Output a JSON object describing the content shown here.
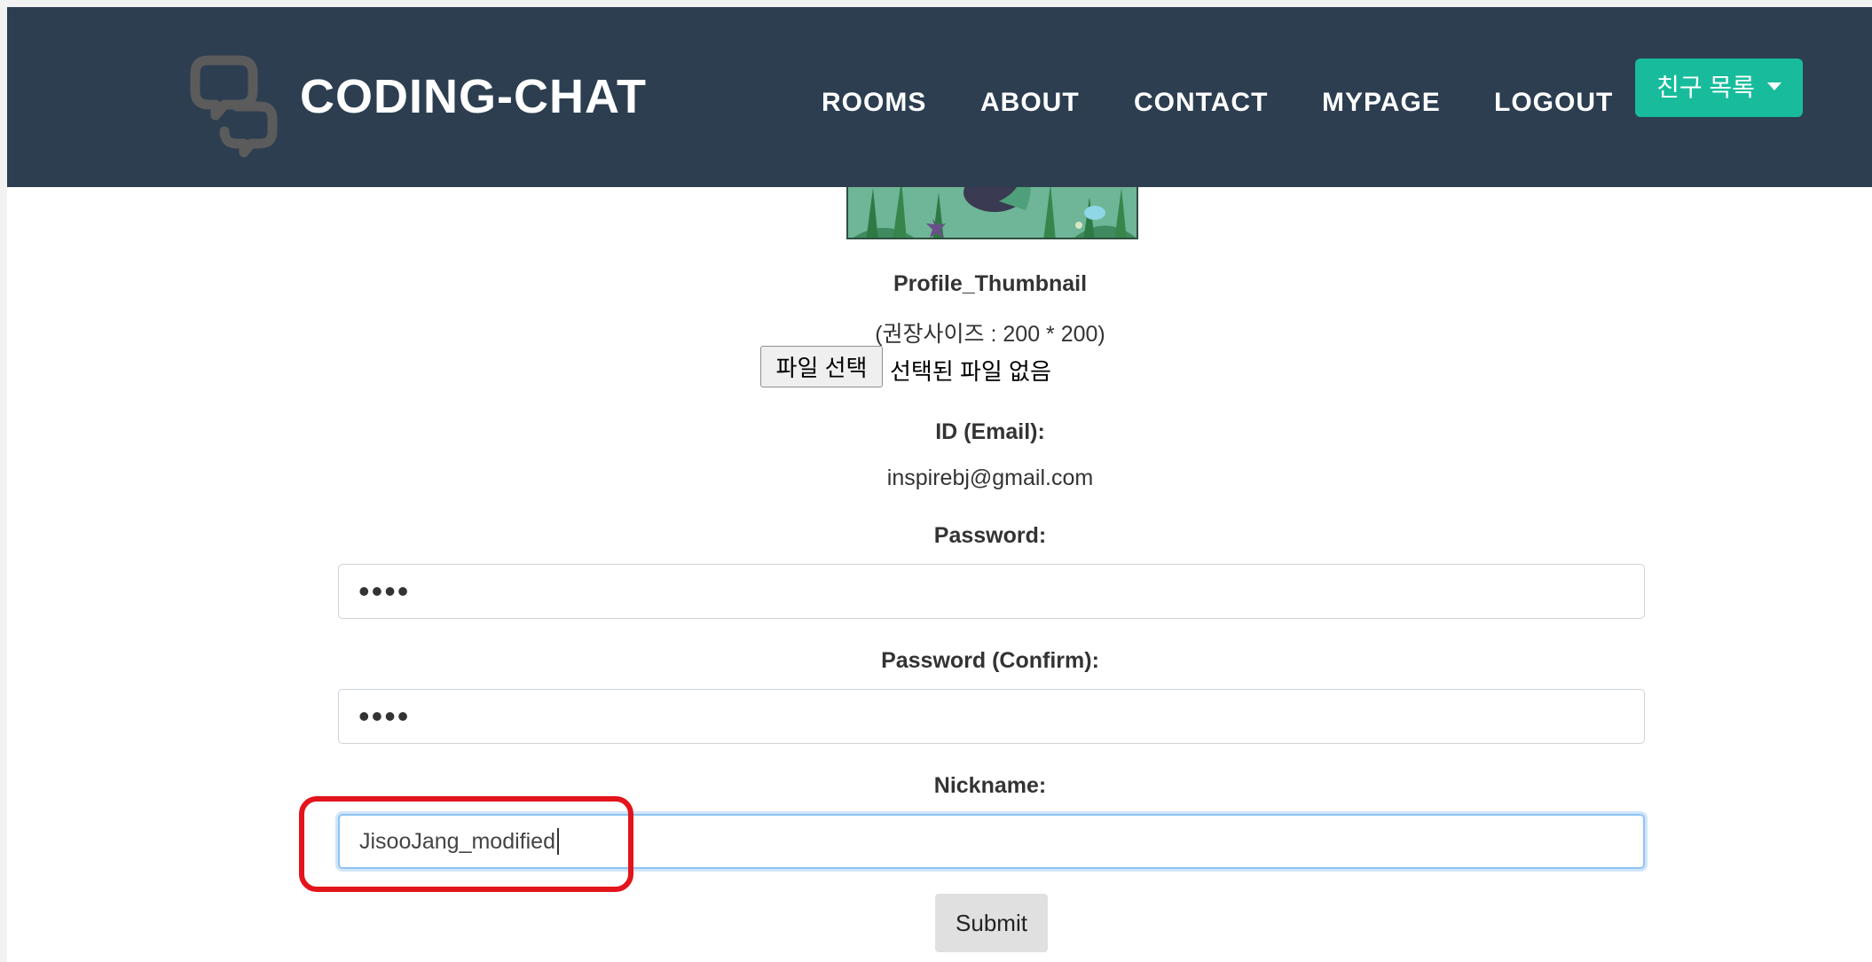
{
  "navbar": {
    "brand": "CODING-CHAT",
    "links": [
      "ROOMS",
      "ABOUT",
      "CONTACT",
      "MYPAGE",
      "LOGOUT"
    ],
    "friends_button": "친구 목록",
    "bg_color": "#2c3e50",
    "accent_color": "#18bc9c"
  },
  "profile": {
    "thumbnail_label": "Profile_Thumbnail",
    "size_hint": "(권장사이즈 : 200 * 200)",
    "file_button": "파일 선택",
    "file_status": "선택된 파일 없음"
  },
  "form": {
    "id_label": "ID (Email):",
    "id_value": "inspirebj@gmail.com",
    "password_label": "Password:",
    "password_value": "••••",
    "password_confirm_label": "Password (Confirm):",
    "password_confirm_value": "••••",
    "nickname_label": "Nickname:",
    "nickname_value": "JisooJang_modified",
    "submit_label": "Submit"
  },
  "annotation": {
    "highlight_color": "#e3141b"
  }
}
